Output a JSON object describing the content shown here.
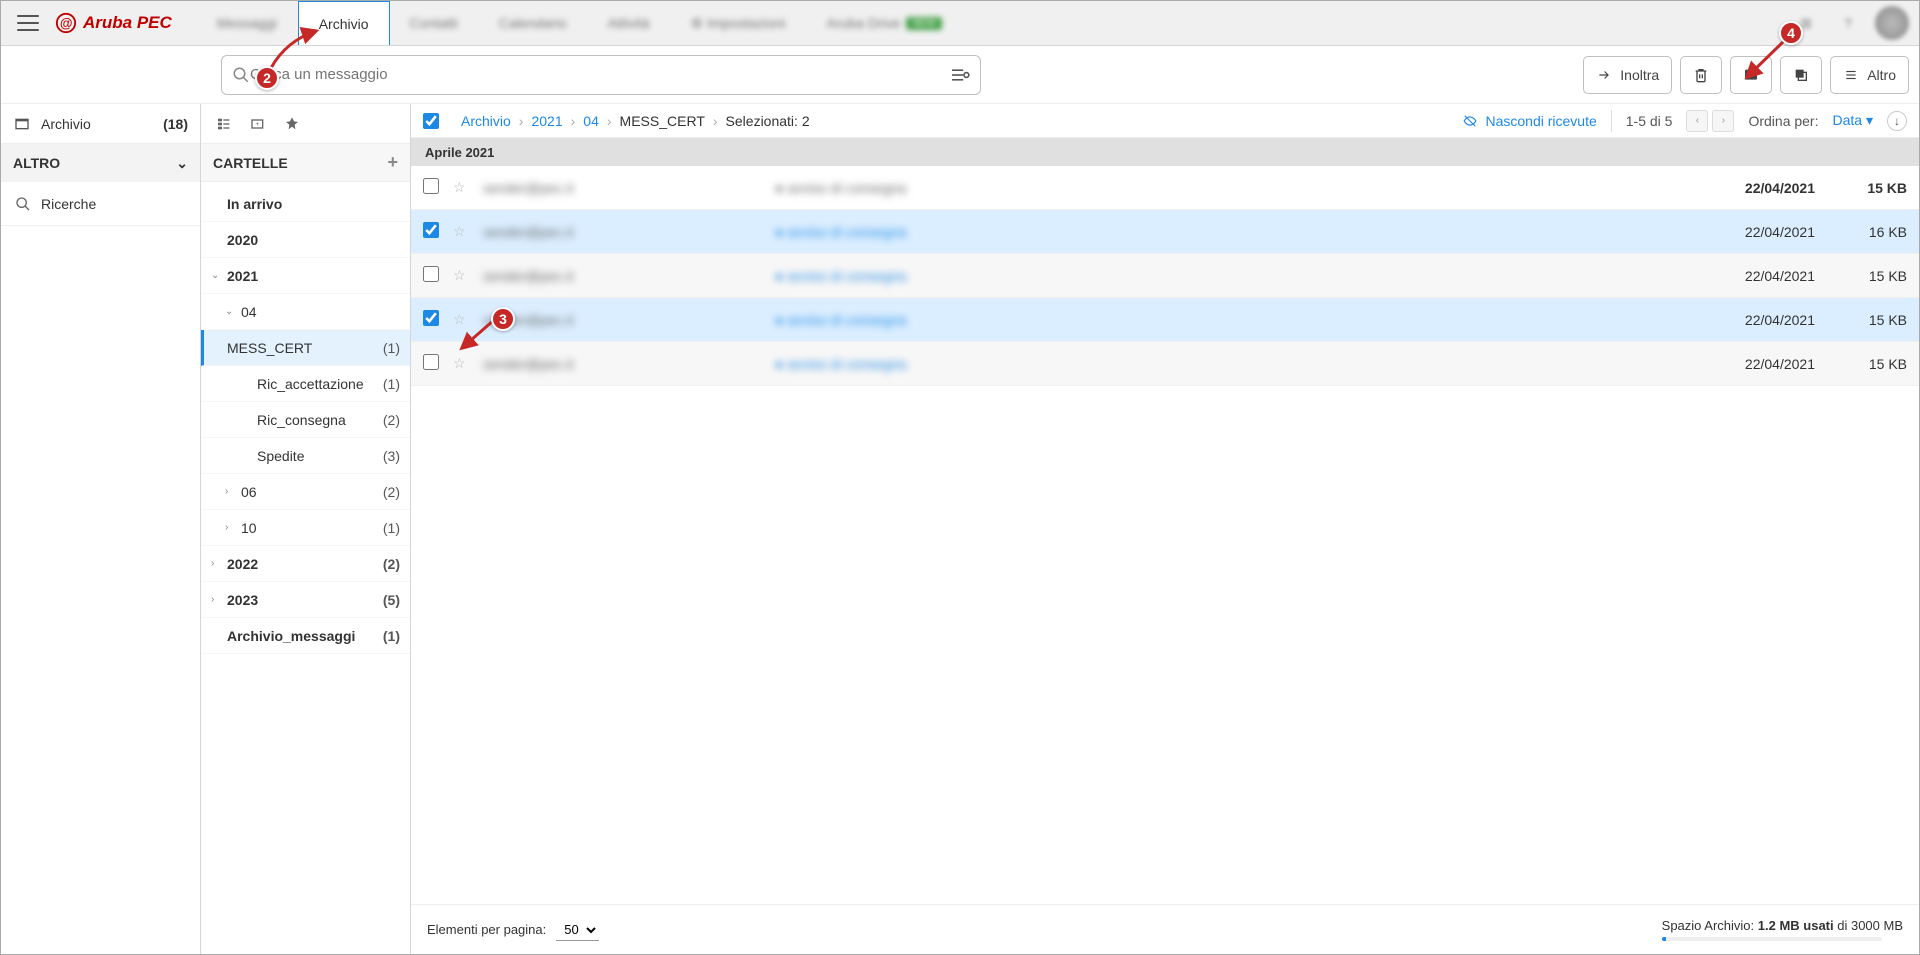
{
  "brand": "Aruba PEC",
  "nav": {
    "tabs": [
      "Messaggi",
      "Archivio",
      "Contatti",
      "Calendario",
      "Attività",
      "Impostazioni",
      "Aruba Drive"
    ],
    "active": "Archivio"
  },
  "search": {
    "placeholder": "Cerca un messaggio"
  },
  "actions": {
    "forward": "Inoltra",
    "more": "Altro"
  },
  "leftSidebar": {
    "archiveLabel": "Archivio",
    "archiveCount": "(18)",
    "sectionOther": "ALTRO",
    "searches": "Ricerche"
  },
  "folders": {
    "header": "CARTELLE",
    "items": [
      {
        "label": "In arrivo",
        "count": "",
        "bold": true,
        "indent": 0,
        "chev": ""
      },
      {
        "label": "2020",
        "count": "",
        "bold": true,
        "indent": 0,
        "chev": ""
      },
      {
        "label": "2021",
        "count": "",
        "bold": true,
        "indent": 0,
        "chev": "down"
      },
      {
        "label": "04",
        "count": "",
        "bold": false,
        "indent": 1,
        "chev": "down"
      },
      {
        "label": "MESS_CERT",
        "count": "(1)",
        "bold": false,
        "indent": 2,
        "chev": "",
        "active": true
      },
      {
        "label": "Ric_accettazione",
        "count": "(1)",
        "bold": false,
        "indent": 2,
        "chev": ""
      },
      {
        "label": "Ric_consegna",
        "count": "(2)",
        "bold": false,
        "indent": 2,
        "chev": ""
      },
      {
        "label": "Spedite",
        "count": "(3)",
        "bold": false,
        "indent": 2,
        "chev": ""
      },
      {
        "label": "06",
        "count": "(2)",
        "bold": false,
        "indent": 1,
        "chev": "right"
      },
      {
        "label": "10",
        "count": "(1)",
        "bold": false,
        "indent": 1,
        "chev": "right"
      },
      {
        "label": "2022",
        "count": "(2)",
        "bold": true,
        "indent": 0,
        "chev": "right"
      },
      {
        "label": "2023",
        "count": "(5)",
        "bold": true,
        "indent": 0,
        "chev": "right"
      },
      {
        "label": "Archivio_messaggi",
        "count": "(1)",
        "bold": true,
        "indent": 0,
        "chev": ""
      }
    ]
  },
  "breadcrumb": {
    "parts": [
      "Archivio",
      "2021",
      "04",
      "MESS_CERT"
    ],
    "selected": "Selezionati: 2",
    "hideReceipts": "Nascondi ricevute",
    "pageInfo": "1-5 di 5",
    "sortLabel": "Ordina per:",
    "sortField": "Data"
  },
  "groupHeader": "Aprile 2021",
  "messages": [
    {
      "checked": false,
      "sel": false,
      "first": true,
      "date": "22/04/2021",
      "size": "15 KB"
    },
    {
      "checked": true,
      "sel": true,
      "date": "22/04/2021",
      "size": "16 KB"
    },
    {
      "checked": false,
      "sel": false,
      "alt": true,
      "date": "22/04/2021",
      "size": "15 KB"
    },
    {
      "checked": true,
      "sel": true,
      "date": "22/04/2021",
      "size": "15 KB"
    },
    {
      "checked": false,
      "sel": false,
      "alt": true,
      "date": "22/04/2021",
      "size": "15 KB"
    }
  ],
  "footer": {
    "perPageLabel": "Elementi per pagina:",
    "perPageValue": "50",
    "storagePrefix": "Spazio Archivio: ",
    "storageUsed": "1.2 MB usati",
    "storageSuffix": " di 3000 MB"
  },
  "annotations": {
    "n2": "2",
    "n3": "3",
    "n4": "4"
  }
}
